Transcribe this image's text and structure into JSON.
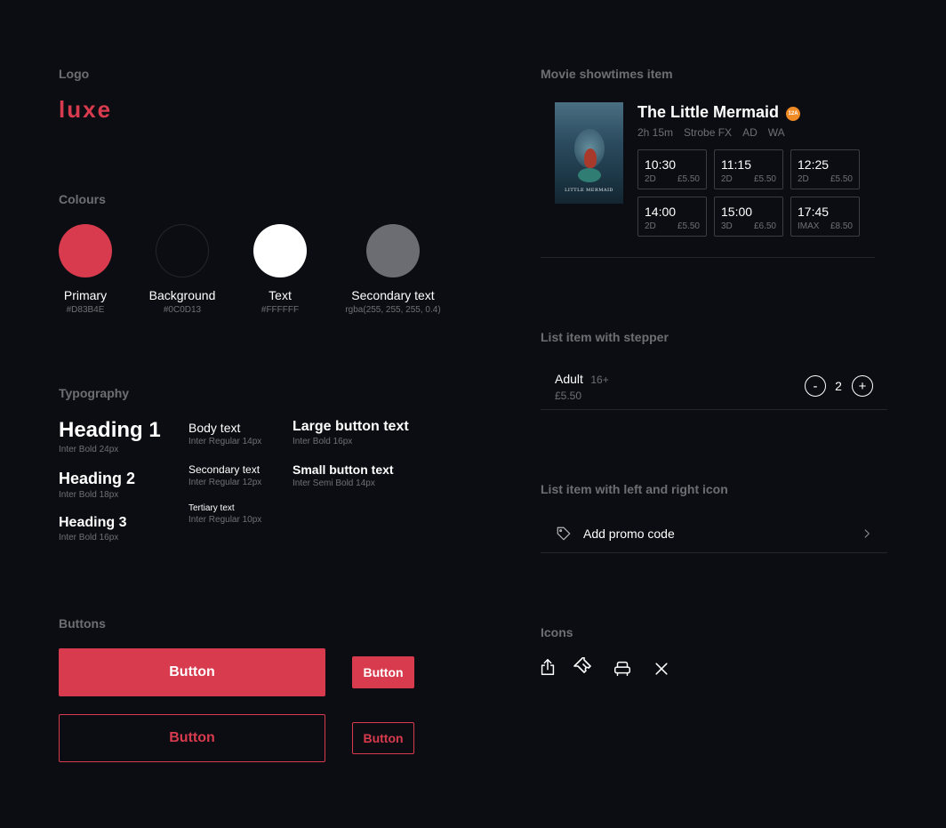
{
  "logo": {
    "section_title": "Logo",
    "text": "luxe"
  },
  "colours": {
    "section_title": "Colours",
    "items": [
      {
        "name": "Primary",
        "code": "#D83B4E",
        "color": "#D83B4E"
      },
      {
        "name": "Background",
        "code": "#0C0D13",
        "color": "#0C0D13"
      },
      {
        "name": "Text",
        "code": "#FFFFFF",
        "color": "#FFFFFF"
      },
      {
        "name": "Secondary text",
        "code": "rgba(255, 255, 255, 0.4)",
        "color": "#6c6d72"
      }
    ]
  },
  "typography": {
    "section_title": "Typography",
    "h1": {
      "label": "Heading 1",
      "note": "Inter Bold 24px"
    },
    "h2": {
      "label": "Heading 2",
      "note": "Inter Bold 18px"
    },
    "h3": {
      "label": "Heading 3",
      "note": "Inter Bold 16px"
    },
    "body": {
      "label": "Body text",
      "note": "Inter Regular 14px"
    },
    "secondary": {
      "label": "Secondary text",
      "note": "Inter Regular 12px"
    },
    "tertiary": {
      "label": "Tertiary text",
      "note": "Inter Regular 10px"
    },
    "large_button": {
      "label": "Large button text",
      "note": "Inter Bold 16px"
    },
    "small_button": {
      "label": "Small button text",
      "note": "Inter Semi Bold 14px"
    }
  },
  "buttons": {
    "section_title": "Buttons",
    "large_filled": "Button",
    "small_filled": "Button",
    "large_outline": "Button",
    "small_outline": "Button"
  },
  "movie": {
    "section_title": "Movie showtimes item",
    "title": "The Little Mermaid",
    "rating": "12A",
    "poster_title": "LITTLE MERMAID",
    "meta": [
      "2h 15m",
      "Strobe FX",
      "AD",
      "WA"
    ],
    "showtimes": [
      {
        "time": "10:30",
        "format": "2D",
        "price": "£5.50"
      },
      {
        "time": "11:15",
        "format": "2D",
        "price": "£5.50"
      },
      {
        "time": "12:25",
        "format": "2D",
        "price": "£5.50"
      },
      {
        "time": "14:00",
        "format": "2D",
        "price": "£5.50"
      },
      {
        "time": "15:00",
        "format": "3D",
        "price": "£6.50"
      },
      {
        "time": "17:45",
        "format": "IMAX",
        "price": "£8.50"
      }
    ]
  },
  "stepper": {
    "section_title": "List item with stepper",
    "label": "Adult",
    "age": "16+",
    "price": "£5.50",
    "minus": "-",
    "count": "2",
    "plus": "+"
  },
  "promo": {
    "section_title": "List item with left and right icon",
    "label": "Add promo code"
  },
  "icons": {
    "section_title": "Icons",
    "items": [
      "share-icon",
      "ticket-icon",
      "seat-icon",
      "close-icon"
    ]
  }
}
